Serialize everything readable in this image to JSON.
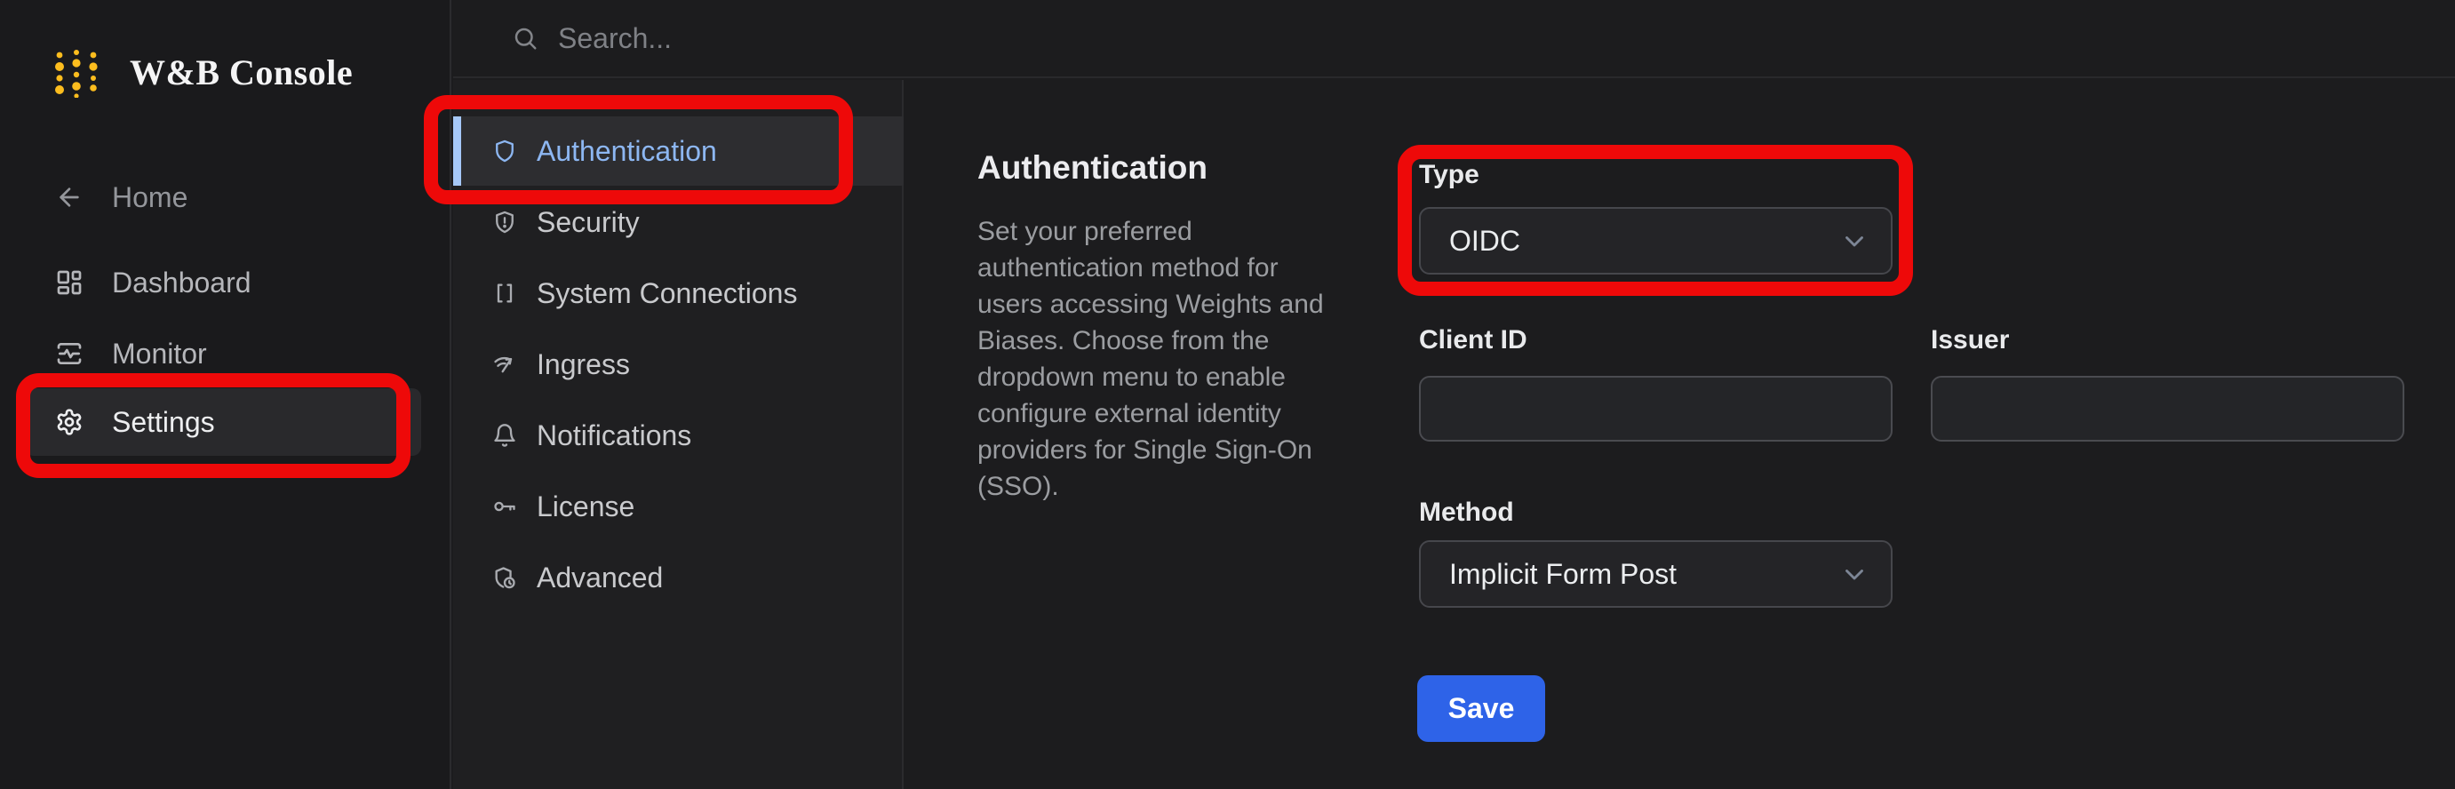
{
  "app": {
    "title": "W&B Console",
    "logo_icon": "wandb-dots-logo"
  },
  "topbar": {
    "search_placeholder": "Search...",
    "search_icon": "search-icon"
  },
  "sidebar": {
    "items": [
      {
        "label": "Home",
        "icon": "back-arrow-icon",
        "active": false
      },
      {
        "label": "Dashboard",
        "icon": "dashboard-icon",
        "active": false
      },
      {
        "label": "Monitor",
        "icon": "monitor-pulse-icon",
        "active": false
      },
      {
        "label": "Settings",
        "icon": "gear-icon",
        "active": true
      }
    ]
  },
  "settings_nav": {
    "items": [
      {
        "label": "Authentication",
        "icon": "shield-icon",
        "active": true
      },
      {
        "label": "Security",
        "icon": "shield-alert-icon",
        "active": false
      },
      {
        "label": "System Connections",
        "icon": "brackets-icon",
        "active": false
      },
      {
        "label": "Ingress",
        "icon": "wifi-arrow-icon",
        "active": false
      },
      {
        "label": "Notifications",
        "icon": "bell-icon",
        "active": false
      },
      {
        "label": "License",
        "icon": "key-icon",
        "active": false
      },
      {
        "label": "Advanced",
        "icon": "shield-clock-icon",
        "active": false
      }
    ]
  },
  "main": {
    "heading": "Authentication",
    "description": "Set your preferred authentication method for users accessing Weights and Biases. Choose from the dropdown menu to enable configure external identity providers for Single Sign-On (SSO).",
    "form": {
      "type_label": "Type",
      "type_value": "OIDC",
      "client_id_label": "Client ID",
      "client_id_value": "",
      "issuer_label": "Issuer",
      "issuer_value": "",
      "method_label": "Method",
      "method_value": "Implicit Form Post",
      "save_label": "Save"
    }
  },
  "annotations": {
    "count": 3,
    "color": "#ee0909",
    "targets": [
      "Settings sidebar item",
      "Authentication nav item",
      "Type dropdown"
    ]
  },
  "colors": {
    "page_bg": "#1c1c1e",
    "sidebar_bg": "#1a1a1c",
    "panel_bg": "#1f1f21",
    "active_row_bg": "#2d2d30",
    "accent_blue_text": "#8db7f2",
    "accent_blue_bar": "#a6c8f8",
    "save_blue": "#2e63e8",
    "annotation_red": "#ee0909",
    "logo_gold": "#fcbd1e"
  }
}
